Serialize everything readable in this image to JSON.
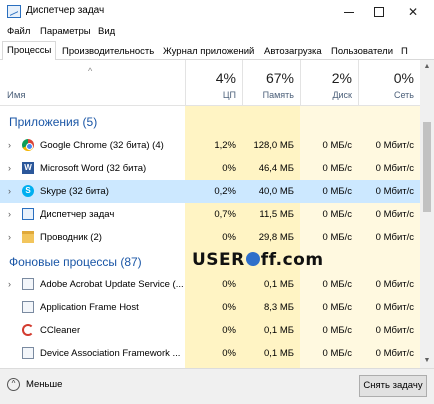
{
  "window": {
    "title": "Диспетчер задач"
  },
  "menu": [
    "Файл",
    "Параметры",
    "Вид"
  ],
  "tabs": [
    "Процессы",
    "Производительность",
    "Журнал приложений",
    "Автозагрузка",
    "Пользователи",
    "П"
  ],
  "columns": {
    "name": "Имя",
    "cpu": {
      "pct": "4%",
      "label": "ЦП"
    },
    "memory": {
      "pct": "67%",
      "label": "Память"
    },
    "disk": {
      "pct": "2%",
      "label": "Диск"
    },
    "network": {
      "pct": "0%",
      "label": "Сеть"
    }
  },
  "groups": {
    "apps": "Приложения (5)",
    "background": "Фоновые процессы (87)"
  },
  "apps": [
    {
      "name": "Google Chrome (32 бита) (4)",
      "icon": "chrome-icon",
      "cpu": "1,2%",
      "mem": "128,0 МБ",
      "disk": "0 МБ/с",
      "net": "0 Мбит/с"
    },
    {
      "name": "Microsoft Word (32 бита)",
      "icon": "word-icon",
      "cpu": "0%",
      "mem": "46,4 МБ",
      "disk": "0 МБ/с",
      "net": "0 Мбит/с"
    },
    {
      "name": "Skype (32 бита)",
      "icon": "skype-icon",
      "cpu": "0,2%",
      "mem": "40,0 МБ",
      "disk": "0 МБ/с",
      "net": "0 Мбит/с"
    },
    {
      "name": "Диспетчер задач",
      "icon": "task-manager-icon",
      "cpu": "0,7%",
      "mem": "11,5 МБ",
      "disk": "0 МБ/с",
      "net": "0 Мбит/с"
    },
    {
      "name": "Проводник (2)",
      "icon": "folder-icon",
      "cpu": "0%",
      "mem": "29,8 МБ",
      "disk": "0 МБ/с",
      "net": "0 Мбит/с"
    }
  ],
  "background": [
    {
      "name": "Adobe Acrobat Update Service (...",
      "icon": "service-icon",
      "cpu": "0%",
      "mem": "0,1 МБ",
      "disk": "0 МБ/с",
      "net": "0 Мбит/с"
    },
    {
      "name": "Application Frame Host",
      "icon": "app-frame-icon",
      "cpu": "0%",
      "mem": "8,3 МБ",
      "disk": "0 МБ/с",
      "net": "0 Мбит/с"
    },
    {
      "name": "CCleaner",
      "icon": "ccleaner-icon",
      "cpu": "0%",
      "mem": "0,1 МБ",
      "disk": "0 МБ/с",
      "net": "0 Мбит/с"
    },
    {
      "name": "Device Association Framework ...",
      "icon": "service-icon",
      "cpu": "0%",
      "mem": "0,1 МБ",
      "disk": "0 МБ/с",
      "net": "0 Мбит/с"
    }
  ],
  "watermark": {
    "left": "USER",
    "right": "ff.com"
  },
  "footer": {
    "less": "Меньше",
    "end_task": "Снять задачу"
  },
  "colors": {
    "accent": "#1a56a6",
    "selected": "#cce8ff",
    "cpu_bg": "#fff4c4"
  }
}
